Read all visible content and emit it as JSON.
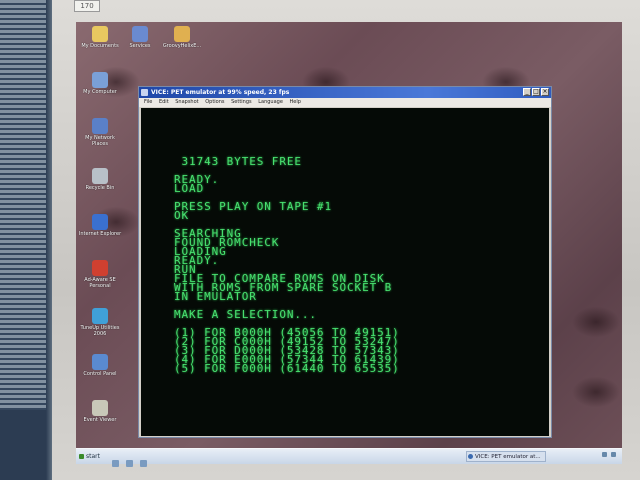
{
  "monitor": {
    "label": "170"
  },
  "desktop": {
    "icons": [
      {
        "label": "My Documents",
        "color": "#e8c860"
      },
      {
        "label": "Services",
        "color": "#6a8ad0"
      },
      {
        "label": "GroovyHelixE...",
        "color": "#e0b050"
      },
      {
        "label": "My Computer",
        "color": "#7aa0d8"
      },
      {
        "label": "My Network Places",
        "color": "#5a80c8"
      },
      {
        "label": "Recycle Bin",
        "color": "#b8c0c8"
      },
      {
        "label": "Internet Explorer",
        "color": "#3a70d0"
      },
      {
        "label": "Ad-Aware SE Personal",
        "color": "#d04030"
      },
      {
        "label": "TuneUp Utilities 2006",
        "color": "#40a0d8"
      },
      {
        "label": "Control Panel",
        "color": "#5a8ad0"
      },
      {
        "label": "Event Viewer",
        "color": "#c8c8b8"
      }
    ]
  },
  "taskbar": {
    "start_label": "start",
    "task_label": "VICE: PET emulator at...",
    "clock": ""
  },
  "vice": {
    "title": "VICE: PET emulator at 99% speed, 23 fps",
    "menu": [
      "File",
      "Edit",
      "Snapshot",
      "Options",
      "Settings",
      "Language",
      "Help"
    ],
    "screen_lines": [
      " 31743 BYTES FREE",
      "",
      "READY.",
      "LOAD",
      "",
      "PRESS PLAY ON TAPE #1",
      "OK",
      "",
      "SEARCHING",
      "FOUND ROMCHECK",
      "LOADING",
      "READY.",
      "RUN",
      "FILE TO COMPARE ROMS ON DISK",
      "WITH ROMS FROM SPARE SOCKET B",
      "IN EMULATOR",
      "",
      "MAKE A SELECTION...",
      "",
      "(1) FOR B000H (45056 TO 49151)",
      "(2) FOR C000H (49152 TO 53247)",
      "(3) FOR D000H (53428 TO 57343)",
      "(4) FOR E000H (57344 TO 61439)",
      "(5) FOR F000H (61440 TO 65535)"
    ],
    "screen_color": "#48e070"
  }
}
